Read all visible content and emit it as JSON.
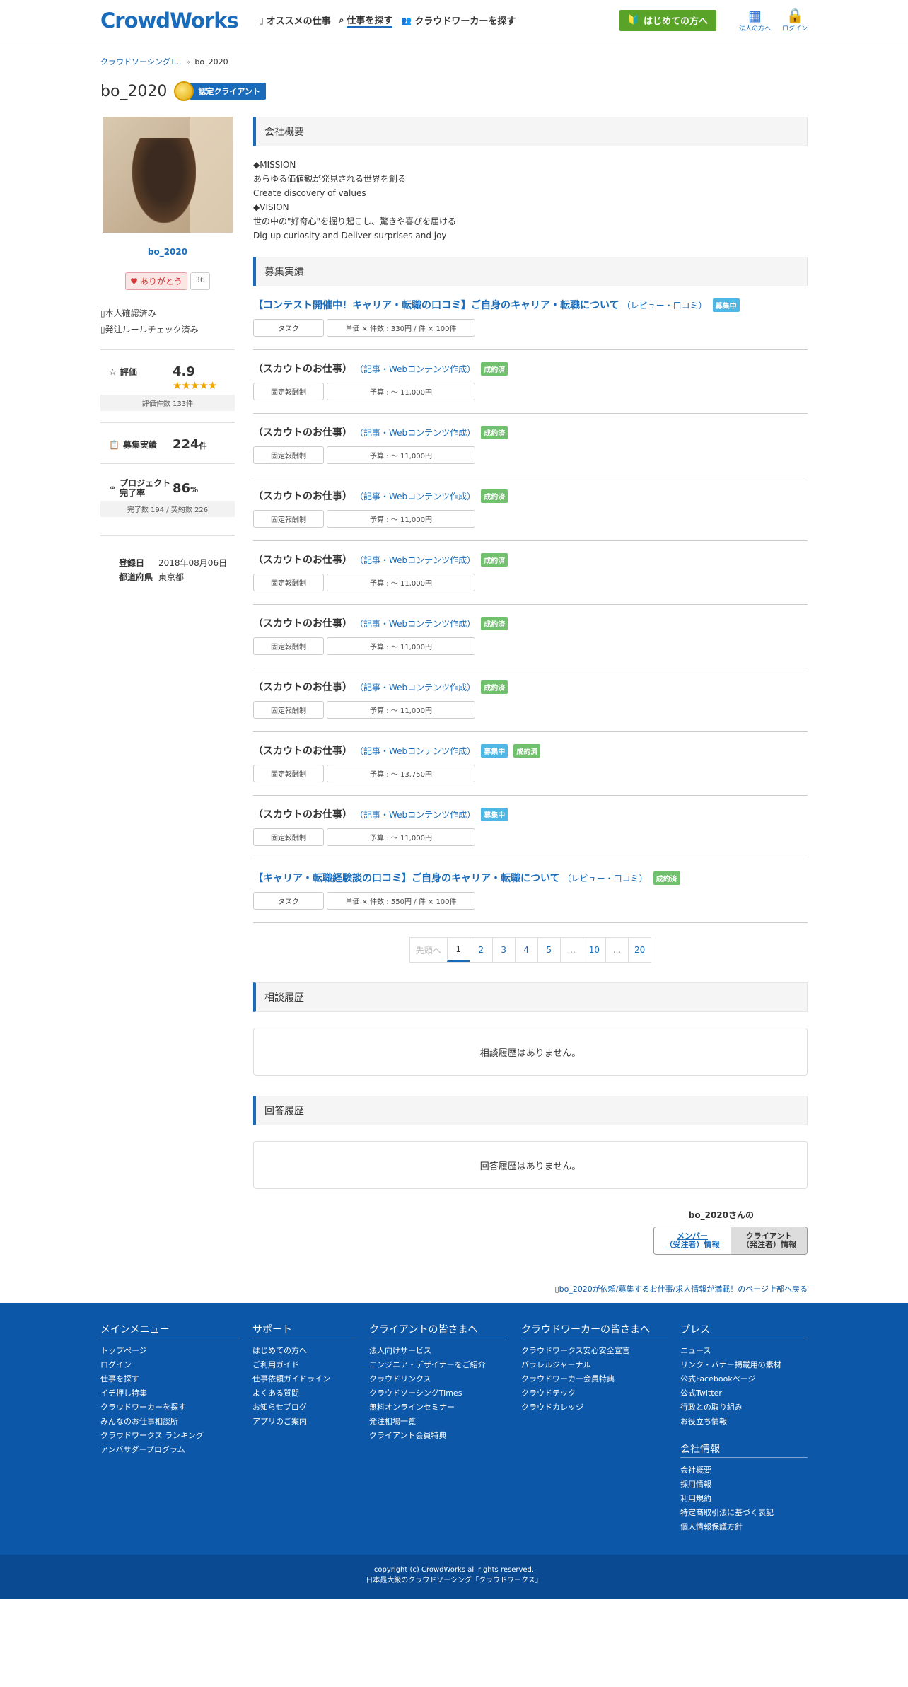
{
  "header": {
    "logo": "CrowdWorks",
    "nav": [
      {
        "label": "オススメの仕事",
        "icon": "phone-icon"
      },
      {
        "label": "仕事を探す",
        "icon": "search-icon"
      },
      {
        "label": "クラウドワーカーを探す",
        "icon": "users-icon"
      }
    ],
    "start_button": "はじめての方へ",
    "corporate_label": "法人の方へ",
    "login_label": "ログイン"
  },
  "breadcrumb": [
    "クラウドソーシングT...",
    "bo_2020"
  ],
  "breadcrumb_sep": "»",
  "page_title": "bo_2020",
  "cert_label": "認定クライアント",
  "sidebar": {
    "name": "bo_2020",
    "thanks_label": "ありがとう",
    "thanks_count": "36",
    "checks": [
      "本人確認済み",
      "発注ルールチェック済み"
    ],
    "rating_label": "評価",
    "rating_value": "4.9",
    "stars": "★★★★★",
    "rating_sub": "評価件数 133件",
    "recruit_label": "募集実績",
    "recruit_value": "224",
    "recruit_unit": "件",
    "complete_label_1": "プロジェクト",
    "complete_label_2": "完了率",
    "complete_value": "86",
    "complete_unit": "%",
    "complete_sub": "完了数 194 / 契約数 226",
    "reg_label": "登録日",
    "reg_value": "2018年08月06日",
    "pref_label": "都道府県",
    "pref_value": "東京都"
  },
  "overview": {
    "heading": "会社概要",
    "lines": [
      "◆MISSION",
      "あらゆる価値観が発見される世界を創る",
      "Create discovery of values",
      "◆VISION",
      "世の中の\"好奇心\"を掘り起こし、驚きや喜びを届ける",
      "Dig up curiosity and Deliver surprises and joy"
    ]
  },
  "jobs_heading": "募集実績",
  "jobs": [
    {
      "title": "【コンテスト開催中！キャリア・転職の口コミ】ご自身のキャリア・転職について",
      "title_link": true,
      "category": "レビュー・口コミ",
      "badges": [
        {
          "label": "募集中",
          "type": "recruit"
        }
      ],
      "tag1": "タスク",
      "tag2": "単価 × 件数 : 330円 / 件 × 100件"
    },
    {
      "title": "（スカウトのお仕事）",
      "title_link": false,
      "category": "記事・Webコンテンツ作成",
      "badges": [
        {
          "label": "成約済",
          "type": "done"
        }
      ],
      "tag1": "固定報酬制",
      "tag2": "予算 : 〜 11,000円"
    },
    {
      "title": "（スカウトのお仕事）",
      "title_link": false,
      "category": "記事・Webコンテンツ作成",
      "badges": [
        {
          "label": "成約済",
          "type": "done"
        }
      ],
      "tag1": "固定報酬制",
      "tag2": "予算 : 〜 11,000円"
    },
    {
      "title": "（スカウトのお仕事）",
      "title_link": false,
      "category": "記事・Webコンテンツ作成",
      "badges": [
        {
          "label": "成約済",
          "type": "done"
        }
      ],
      "tag1": "固定報酬制",
      "tag2": "予算 : 〜 11,000円"
    },
    {
      "title": "（スカウトのお仕事）",
      "title_link": false,
      "category": "記事・Webコンテンツ作成",
      "badges": [
        {
          "label": "成約済",
          "type": "done"
        }
      ],
      "tag1": "固定報酬制",
      "tag2": "予算 : 〜 11,000円"
    },
    {
      "title": "（スカウトのお仕事）",
      "title_link": false,
      "category": "記事・Webコンテンツ作成",
      "badges": [
        {
          "label": "成約済",
          "type": "done"
        }
      ],
      "tag1": "固定報酬制",
      "tag2": "予算 : 〜 11,000円"
    },
    {
      "title": "（スカウトのお仕事）",
      "title_link": false,
      "category": "記事・Webコンテンツ作成",
      "badges": [
        {
          "label": "成約済",
          "type": "done"
        }
      ],
      "tag1": "固定報酬制",
      "tag2": "予算 : 〜 11,000円"
    },
    {
      "title": "（スカウトのお仕事）",
      "title_link": false,
      "category": "記事・Webコンテンツ作成",
      "badges": [
        {
          "label": "募集中",
          "type": "recruit"
        },
        {
          "label": "成約済",
          "type": "done"
        }
      ],
      "tag1": "固定報酬制",
      "tag2": "予算 : 〜 13,750円"
    },
    {
      "title": "（スカウトのお仕事）",
      "title_link": false,
      "category": "記事・Webコンテンツ作成",
      "badges": [
        {
          "label": "募集中",
          "type": "recruit"
        }
      ],
      "tag1": "固定報酬制",
      "tag2": "予算 : 〜 11,000円"
    },
    {
      "title": "【キャリア・転職経験談の口コミ】ご自身のキャリア・転職について",
      "title_link": true,
      "category": "レビュー・口コミ",
      "badges": [
        {
          "label": "成約済",
          "type": "done"
        }
      ],
      "tag1": "タスク",
      "tag2": "単価 × 件数 : 550円 / 件 × 100件"
    }
  ],
  "pager": [
    "先頭へ",
    "1",
    "2",
    "3",
    "4",
    "5",
    "...",
    "10",
    "...",
    "20"
  ],
  "consult": {
    "heading": "相談履歴",
    "empty": "相談履歴はありません。"
  },
  "answer": {
    "heading": "回答履歴",
    "empty": "回答履歴はありません。"
  },
  "switcher": {
    "label": "bo_2020さんの",
    "member_1": "メンバー",
    "member_2": "（受注者）情報",
    "client_1": "クライアント",
    "client_2": "（発注者）情報"
  },
  "back_top": "bo_2020が依頼/募集するお仕事/求人情報が満載！のページ上部へ戻る",
  "footer": {
    "cols": [
      {
        "heading": "メインメニュー",
        "links": [
          "トップページ",
          "ログイン",
          "仕事を探す",
          "イチ押し特集",
          "クラウドワーカーを探す",
          "みんなのお仕事相談所",
          "クラウドワークス ランキング",
          "アンバサダープログラム"
        ]
      },
      {
        "heading": "サポート",
        "links": [
          "はじめての方へ",
          "ご利用ガイド",
          "仕事依頼ガイドライン",
          "よくある質問",
          "お知らせブログ",
          "アプリのご案内"
        ]
      },
      {
        "heading": "クライアントの皆さまへ",
        "links": [
          "法人向けサービス",
          "エンジニア・デザイナーをご紹介",
          "クラウドリンクス",
          "クラウドソーシングTimes",
          "無料オンラインセミナー",
          "発注相場一覧",
          "クライアント会員特典"
        ]
      },
      {
        "heading": "クラウドワーカーの皆さまへ",
        "links": [
          "クラウドワークス安心安全宣言",
          "パラレルジャーナル",
          "クラウドワーカー会員特典",
          "クラウドテック",
          "クラウドカレッジ"
        ]
      },
      {
        "heading": "プレス",
        "links": [
          "ニュース",
          "リンク・バナー掲載用の素材",
          "公式Facebookページ",
          "公式Twitter",
          "行政との取り組み",
          "お役立ち情報"
        ]
      }
    ],
    "company_heading": "会社情報",
    "company_links": [
      "会社概要",
      "採用情報",
      "利用規約",
      "特定商取引法に基づく表記",
      "個人情報保護方針"
    ],
    "copyright": "copyright (c) CrowdWorks all rights reserved.",
    "tagline": "日本最大級のクラウドソーシング「クラウドワークス」"
  }
}
